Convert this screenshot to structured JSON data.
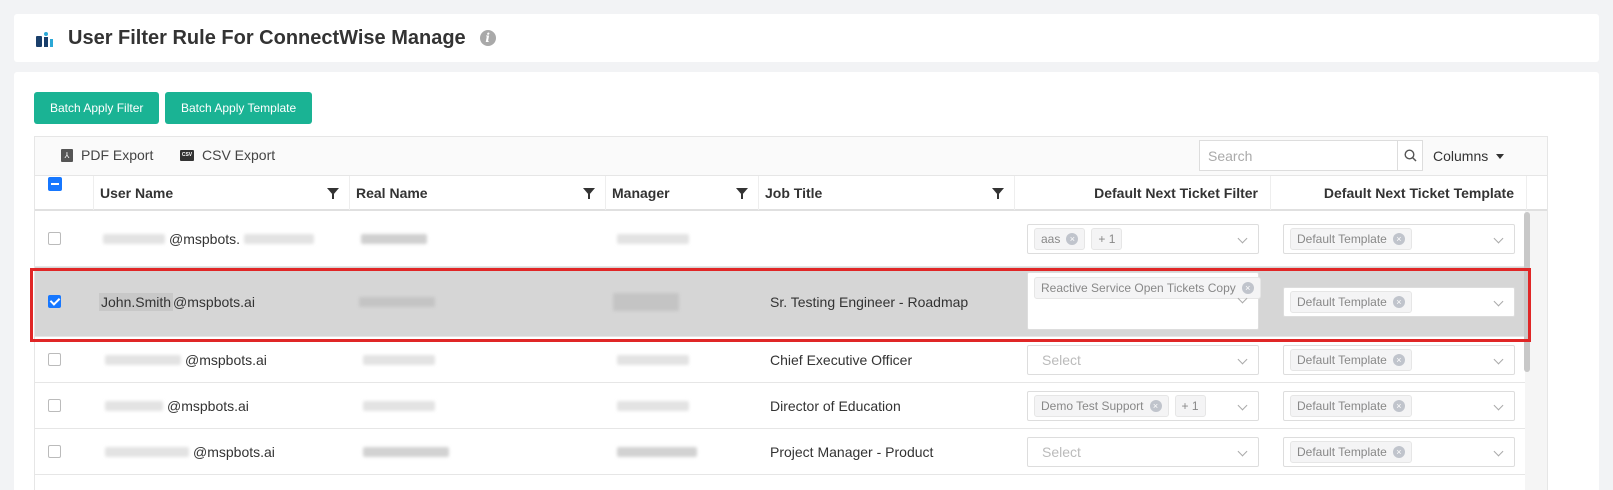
{
  "header": {
    "title": "User Filter Rule For ConnectWise Manage",
    "info_icon": "info-icon"
  },
  "actions": {
    "batch_filter": "Batch Apply Filter",
    "batch_template": "Batch Apply Template"
  },
  "toolbar": {
    "pdf_export": "PDF Export",
    "csv_export": "CSV Export",
    "search_placeholder": "Search",
    "columns": "Columns",
    "csv_icon_text": "CSV"
  },
  "columns": {
    "user_name": "User Name",
    "real_name": "Real Name",
    "manager": "Manager",
    "job_title": "Job Title",
    "default_filter": "Default Next Ticket Filter",
    "default_template": "Default Next Ticket Template"
  },
  "rows": [
    {
      "user_suffix": "@mspbots.",
      "job_title": "",
      "filter_tags": [
        "aas"
      ],
      "filter_more": "+ 1",
      "filter_placeholder": "",
      "template_tag": "Default Template",
      "checked": false
    },
    {
      "user_prefix": "John.Smith",
      "user_suffix": "@mspbots.ai",
      "job_title": "Sr. Testing Engineer - Roadmap",
      "filter_tags": [
        "Reactive Service Open Tickets Copy"
      ],
      "filter_more": "",
      "filter_placeholder": "",
      "template_tag": "Default Template",
      "checked": true
    },
    {
      "user_suffix": "@mspbots.ai",
      "job_title": "Chief Executive Officer",
      "filter_tags": [],
      "filter_more": "",
      "filter_placeholder": "Select",
      "template_tag": "Default Template",
      "checked": false
    },
    {
      "user_suffix": "@mspbots.ai",
      "job_title": "Director of Education",
      "filter_tags": [
        "Demo Test Support"
      ],
      "filter_more": "+ 1",
      "filter_placeholder": "",
      "template_tag": "Default Template",
      "checked": false
    },
    {
      "user_suffix": "@mspbots.ai",
      "job_title": "Project Manager - Product",
      "filter_tags": [],
      "filter_more": "",
      "filter_placeholder": "Select",
      "template_tag": "Default Template",
      "checked": false
    }
  ],
  "colors": {
    "accent": "#1ab394",
    "checkbox": "#1677ff",
    "highlight": "#e02626"
  }
}
